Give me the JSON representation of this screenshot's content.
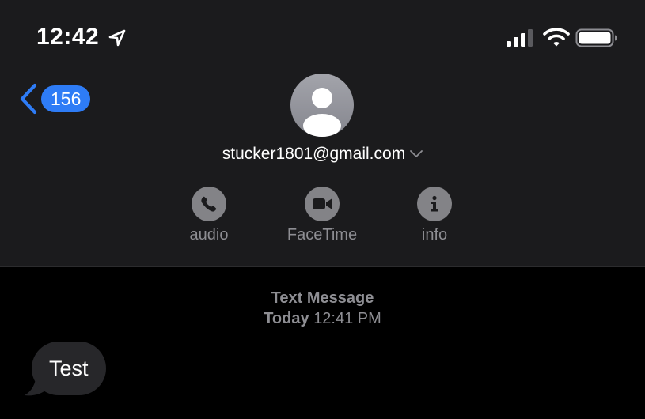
{
  "status_bar": {
    "time": "12:42",
    "location_icon": "location-arrow-icon",
    "signal_icon": "cellular-signal-icon",
    "wifi_icon": "wifi-icon",
    "battery_icon": "battery-icon"
  },
  "nav": {
    "back_icon": "chevron-left-icon",
    "unread_count": "156"
  },
  "contact": {
    "avatar_icon": "person-silhouette-icon",
    "name": "stucker1801@gmail.com",
    "expand_icon": "chevron-down-icon"
  },
  "actions": [
    {
      "label": "audio",
      "icon": "phone-icon"
    },
    {
      "label": "FaceTime",
      "icon": "video-camera-icon"
    },
    {
      "label": "info",
      "icon": "info-icon"
    }
  ],
  "conversation": {
    "service": "Text Message",
    "day": "Today",
    "time": "12:41 PM",
    "messages": [
      {
        "direction": "incoming",
        "text": "Test"
      }
    ]
  },
  "colors": {
    "header_bg": "#1b1b1d",
    "background": "#000000",
    "accent": "#2e7cf6",
    "incoming_bubble": "#27272a",
    "secondary_text": "#8e8e93",
    "icon_circle": "#838387"
  }
}
